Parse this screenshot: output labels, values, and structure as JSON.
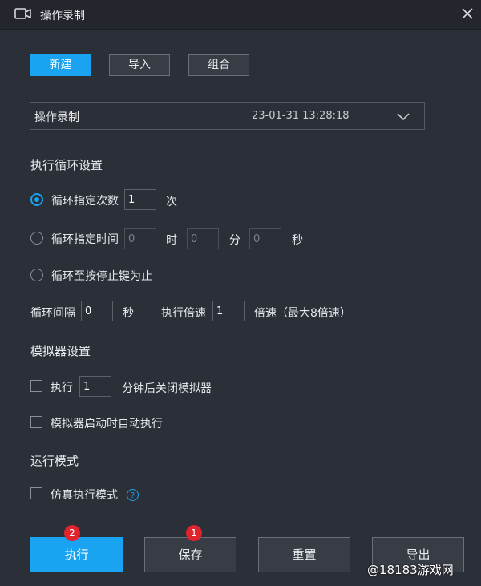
{
  "window": {
    "title": "操作录制",
    "icon": "video-camera-icon",
    "close_icon": "close-icon"
  },
  "toolbar": {
    "new_label": "新建",
    "import_label": "导入",
    "combine_label": "组合"
  },
  "recording": {
    "name": "操作录制",
    "timestamp": "23-01-31 13:28:18"
  },
  "loop_settings": {
    "heading": "执行循环设置",
    "option_count_label": "循环指定次数",
    "count_value": "1",
    "count_unit": "次",
    "option_time_label": "循环指定时间",
    "hours_value": "0",
    "hours_unit": "时",
    "minutes_value": "0",
    "minutes_unit": "分",
    "seconds_value": "0",
    "seconds_unit": "秒",
    "option_stop_label": "循环至按停止键为止",
    "selected_option": "count",
    "interval_label": "循环间隔",
    "interval_value": "0",
    "interval_unit": "秒",
    "speed_label": "执行倍速",
    "speed_value": "1",
    "speed_unit": "倍速（最大8倍速）"
  },
  "emulator_settings": {
    "heading": "模拟器设置",
    "close_prefix": "执行",
    "close_minutes_value": "1",
    "close_suffix": "分钟后关闭模拟器",
    "close_checked": false,
    "autorun_label": "模拟器启动时自动执行",
    "autorun_checked": false
  },
  "run_mode": {
    "heading": "运行模式",
    "simulate_label": "仿真执行模式",
    "simulate_checked": false,
    "help_symbol": "?"
  },
  "actions": {
    "execute_label": "执行",
    "execute_badge": "2",
    "save_label": "保存",
    "save_badge": "1",
    "reset_label": "重置",
    "export_label": "导出"
  },
  "watermark": "@18183游戏网",
  "colors": {
    "accent": "#1aa3f0",
    "background": "#2b2f38",
    "titlebar": "#23262d",
    "badge": "#e0242e"
  }
}
